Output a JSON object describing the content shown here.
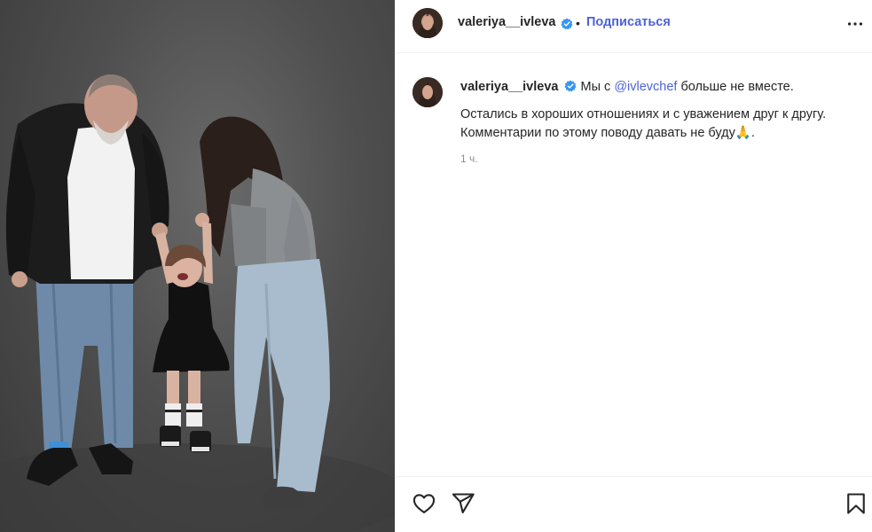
{
  "post": {
    "username": "valeriya__ivleva",
    "follow_label": "Подписаться",
    "separator": "•",
    "caption": {
      "intro_text": "Мы с",
      "mention": "@ivlevchef",
      "intro_tail": "больше не вместе.",
      "line2": "Остались в хороших отношениях и с уважением друг к другу.",
      "line3": "Комментарии по этому поводу давать не буду🙏.",
      "timestamp": "1 ч."
    }
  },
  "icons": {
    "verified": "verified-badge-icon",
    "more": "more-options-icon",
    "like": "heart-icon",
    "share": "paper-plane-icon",
    "save": "bookmark-icon"
  },
  "colors": {
    "link": "#4d63d9",
    "verified": "#3897f0",
    "text": "#262626",
    "muted": "#8e8e8e",
    "divider": "#efefef"
  }
}
